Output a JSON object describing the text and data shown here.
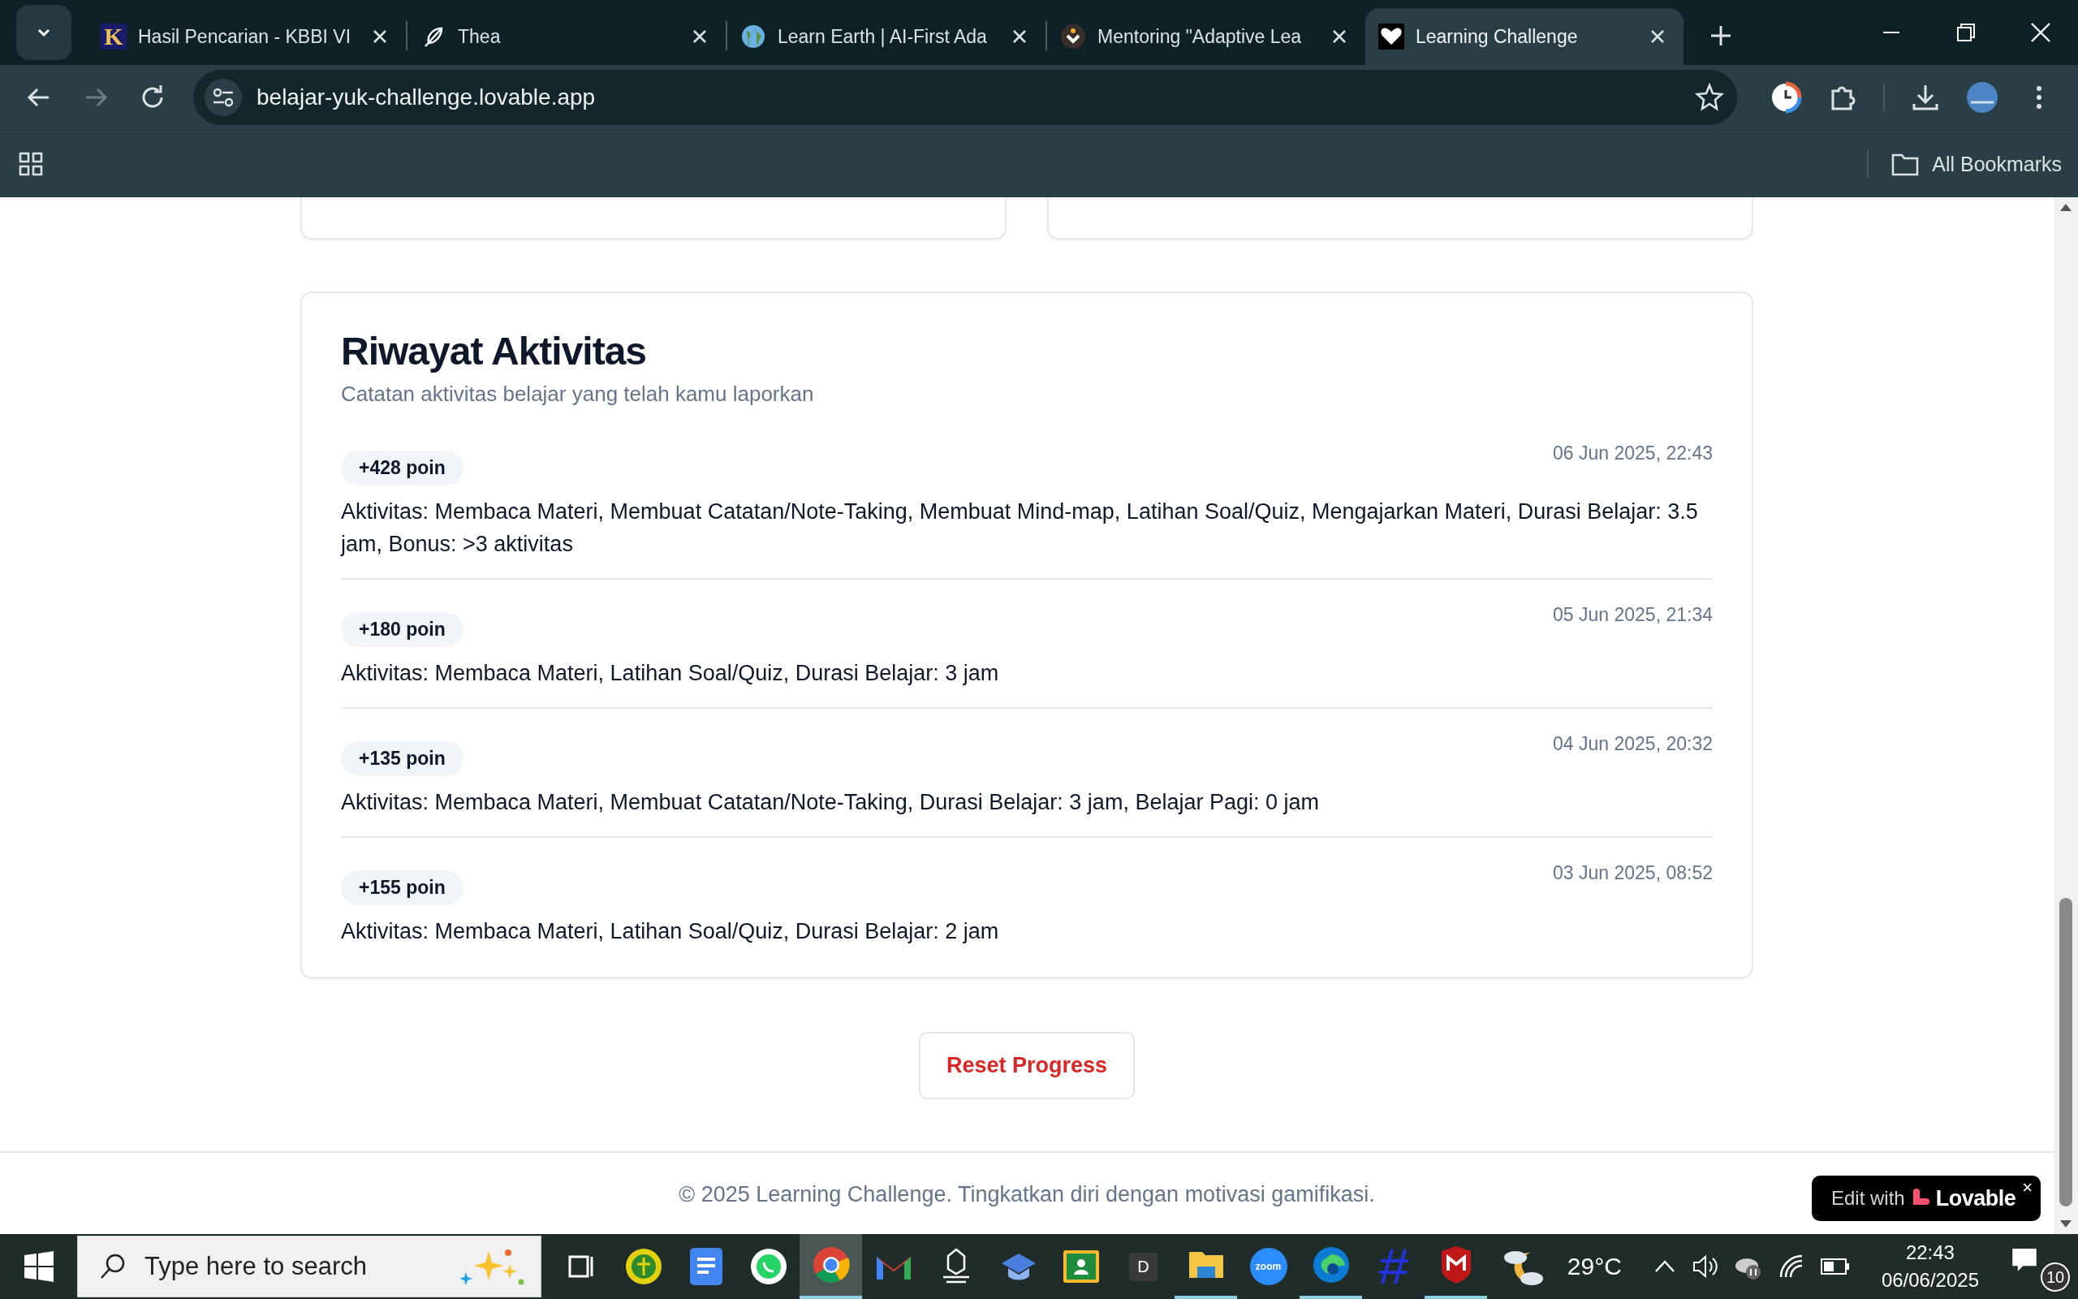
{
  "browser": {
    "tabs": [
      {
        "title": "Hasil Pencarian - KBBI VI",
        "kind": "letter",
        "icon_letter": "K",
        "selected": false
      },
      {
        "title": "Thea",
        "kind": "feather",
        "selected": false
      },
      {
        "title": "Learn Earth | AI-First Ada",
        "kind": "globe",
        "selected": false
      },
      {
        "title": "Mentoring \"Adaptive Lea",
        "kind": "chevron",
        "selected": false
      },
      {
        "title": "Learning Challenge",
        "kind": "heart",
        "selected": true
      }
    ],
    "url": "belajar-yuk-challenge.lovable.app",
    "bookmarks_label": "All Bookmarks"
  },
  "page": {
    "history": {
      "title": "Riwayat Aktivitas",
      "subtitle": "Catatan aktivitas belajar yang telah kamu laporkan",
      "entries": [
        {
          "points": "+428 poin",
          "date": "06 Jun 2025, 22:43",
          "text": "Aktivitas: Membaca Materi, Membuat Catatan/Note-Taking, Membuat Mind-map, Latihan Soal/Quiz, Mengajarkan Materi, Durasi Belajar: 3.5 jam, Bonus: >3 aktivitas"
        },
        {
          "points": "+180 poin",
          "date": "05 Jun 2025, 21:34",
          "text": "Aktivitas: Membaca Materi, Latihan Soal/Quiz, Durasi Belajar: 3 jam"
        },
        {
          "points": "+135 poin",
          "date": "04 Jun 2025, 20:32",
          "text": "Aktivitas: Membaca Materi, Membuat Catatan/Note-Taking, Durasi Belajar: 3 jam, Belajar Pagi: 0 jam"
        },
        {
          "points": "+155 poin",
          "date": "03 Jun 2025, 08:52",
          "text": "Aktivitas: Membaca Materi, Latihan Soal/Quiz, Durasi Belajar: 2 jam"
        }
      ]
    },
    "reset_button": "Reset Progress",
    "footer": "© 2025 Learning Challenge. Tingkatkan diri dengan motivasi gamifikasi.",
    "edit_badge": {
      "prefix": "Edit with",
      "brand": "Lovable",
      "close": "×"
    }
  },
  "taskbar": {
    "search_placeholder": "Type here to search",
    "apps": [
      {
        "kind": "taskview",
        "running": false,
        "selected": false
      },
      {
        "kind": "emblem",
        "running": false,
        "selected": false
      },
      {
        "kind": "docs",
        "running": false,
        "selected": false
      },
      {
        "kind": "whatsapp",
        "running": false,
        "selected": false
      },
      {
        "kind": "chrome",
        "running": true,
        "selected": true
      },
      {
        "kind": "gmail",
        "running": false,
        "selected": false
      },
      {
        "kind": "crest",
        "running": false,
        "selected": false
      },
      {
        "kind": "cap",
        "running": false,
        "selected": false
      },
      {
        "kind": "classroom",
        "running": false,
        "selected": false
      },
      {
        "kind": "letter",
        "label": "D",
        "running": false,
        "selected": false
      },
      {
        "kind": "files",
        "running": true,
        "selected": false
      },
      {
        "kind": "zoom",
        "label": "zoom",
        "running": false,
        "selected": false
      },
      {
        "kind": "edge",
        "running": true,
        "selected": false
      },
      {
        "kind": "hash",
        "running": false,
        "selected": false
      },
      {
        "kind": "shield",
        "running": true,
        "selected": false
      }
    ],
    "weather": "29°C",
    "time": "22:43",
    "date": "06/06/2025",
    "notifications": "10"
  }
}
